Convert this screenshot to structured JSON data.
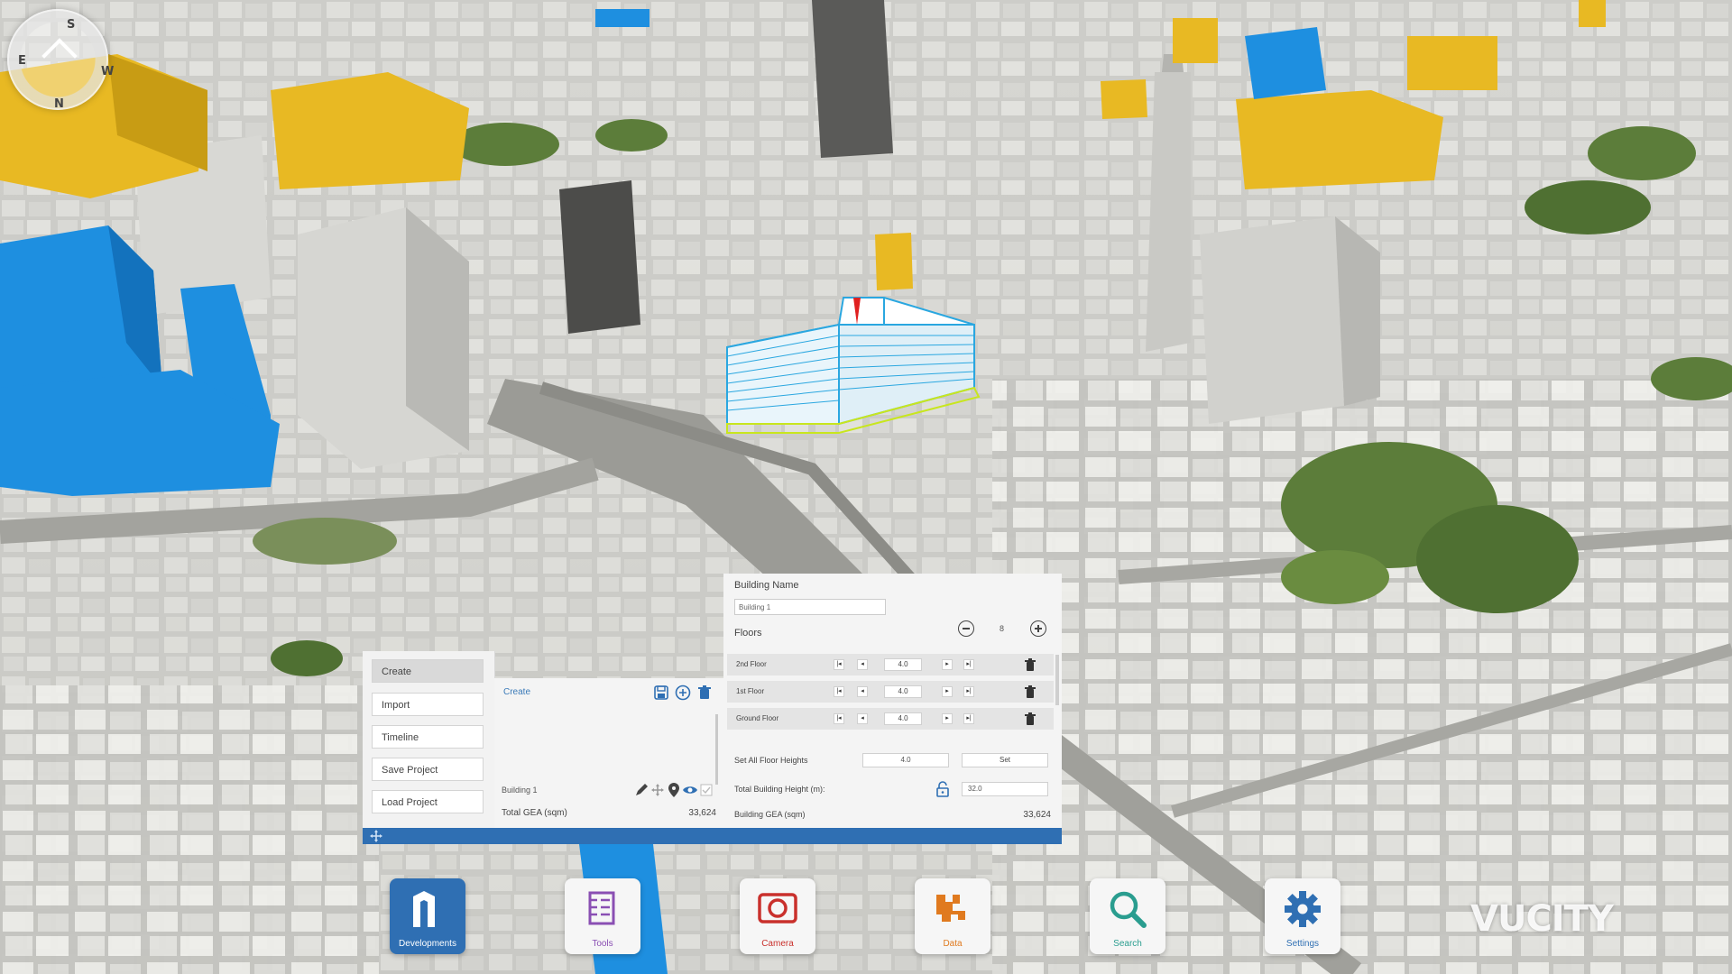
{
  "compass": {
    "n": "N",
    "s": "S",
    "e": "E",
    "w": "W"
  },
  "menu": {
    "items": [
      {
        "label": "Create",
        "active": true
      },
      {
        "label": "Import"
      },
      {
        "label": "Timeline"
      },
      {
        "label": "Save Project"
      },
      {
        "label": "Load Project"
      }
    ]
  },
  "projects": {
    "title": "Create",
    "buildings": [
      {
        "name": "Building 1"
      }
    ],
    "total_label": "Total GEA (sqm)",
    "total_value": "33,624"
  },
  "building": {
    "name_label": "Building Name",
    "name_value": "Building 1",
    "floors_label": "Floors",
    "floors_count": "8",
    "floors": [
      {
        "name": "2nd Floor",
        "height": "4.0"
      },
      {
        "name": "1st Floor",
        "height": "4.0"
      },
      {
        "name": "Ground Floor",
        "height": "4.0"
      }
    ],
    "set_all_label": "Set All Floor Heights",
    "set_all_value": "4.0",
    "set_button": "Set",
    "total_height_label": "Total Building Height (m):",
    "total_height_value": "32.0",
    "gea_label": "Building GEA (sqm)",
    "gea_value": "33,624"
  },
  "dock": [
    {
      "label": "Developments",
      "icon": "developments-icon",
      "active": true
    },
    {
      "label": "Tools",
      "icon": "tools-icon"
    },
    {
      "label": "Camera",
      "icon": "camera-icon"
    },
    {
      "label": "Data",
      "icon": "data-icon"
    },
    {
      "label": "Search",
      "icon": "search-icon"
    },
    {
      "label": "Settings",
      "icon": "settings-icon"
    }
  ],
  "brand": {
    "logo": "VUCITY"
  },
  "colors": {
    "accent": "#2f6fb3",
    "highlight_building": "#2aa7e0",
    "yellow_building": "#e8b923",
    "blue_building": "#1e8fe0",
    "tools": "#8a4fb3",
    "camera": "#c9302c",
    "data": "#e07a1f",
    "search": "#2a9d8f"
  }
}
